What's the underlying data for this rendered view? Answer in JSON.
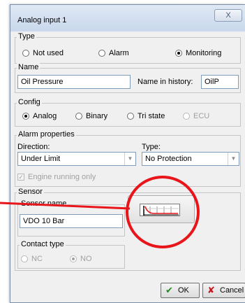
{
  "window": {
    "title": "Analog input 1",
    "close_glyph": "X"
  },
  "type_group": {
    "title": "Type",
    "options": [
      {
        "label": "Not used",
        "checked": false,
        "disabled": false
      },
      {
        "label": "Alarm",
        "checked": false,
        "disabled": false
      },
      {
        "label": "Monitoring",
        "checked": true,
        "disabled": false
      }
    ]
  },
  "name_group": {
    "title": "Name",
    "name_value": "Oil Pressure",
    "history_label": "Name in history:",
    "history_value": "OilP"
  },
  "config_group": {
    "title": "Config",
    "options": [
      {
        "label": "Analog",
        "checked": true,
        "disabled": false
      },
      {
        "label": "Binary",
        "checked": false,
        "disabled": false
      },
      {
        "label": "Tri state",
        "checked": false,
        "disabled": false
      },
      {
        "label": "ECU",
        "checked": false,
        "disabled": true
      }
    ]
  },
  "alarm_group": {
    "title": "Alarm properties",
    "direction_label": "Direction:",
    "direction_value": "Under Limit",
    "type_label": "Type:",
    "type_value": "No Protection",
    "engine_running_label": "Engine running only",
    "engine_running_checked": true,
    "engine_running_disabled": true
  },
  "sensor_group": {
    "title": "Sensor",
    "sensor_name_title": "Sensor name",
    "sensor_name_value": "VDO 10 Bar",
    "sensor_curve_icon": "sensor-curve-icon",
    "contact_title": "Contact type",
    "contact_options": [
      {
        "label": "NC",
        "checked": false,
        "disabled": true
      },
      {
        "label": "NO",
        "checked": true,
        "disabled": true
      }
    ]
  },
  "buttons": {
    "ok": "OK",
    "cancel": "Cancel"
  },
  "annotation": {
    "color": "#e8151b",
    "shape": "circle-with-pointer-line"
  }
}
